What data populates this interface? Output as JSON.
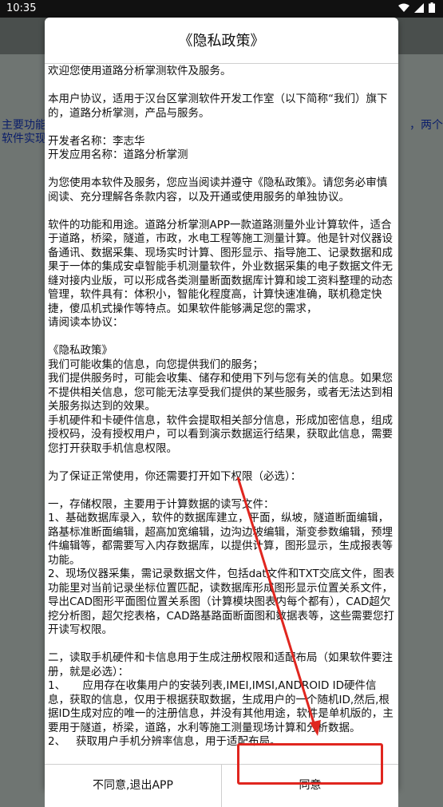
{
  "status_bar": {
    "time": "10:35"
  },
  "background": {
    "left_lines": [
      "主要功能",
      "软件实现"
    ],
    "right_lines": [
      "，两个"
    ]
  },
  "dialog": {
    "title": "《隐私政策》",
    "content": "欢迎您使用道路分析掌测软件及服务。\n\n本用户协议，适用于汉台区掌测软件开发工作室（以下简称“我们）旗下的，道路分析掌测，产品与服务。\n\n开发者名称：李志华\n开发应用名称：道路分析掌测\n\n为您使用本软件及服务，您应当阅读并遵守《隐私政策》。请您务必审慎阅读、充分理解各条款内容，以及开通或使用服务的单独协议。\n\n软件的功能和用途。道路分析掌测APP一款道路测量外业计算软件，适合于道路，桥梁，隧道，市政，水电工程等施工测量计算。他是针对仪器设备通讯、数据采集、现场实时计算、图形显示、指导施工、记录数据和成果于一体的集成安卓智能手机测量软件，外业数据采集的电子数据文件无缝对接内业版，可以形成各类测量断面数据库计算和竣工资料整理的动态管理，软件具有：体积小，智能化程度高，计算快速准确，联机稳定快捷，傻瓜机式操作等特点。如果软件能够满足您的需求，\n请阅读本协议：\n\n《隐私政策》\n我们可能收集的信息，向您提供我们的服务；\n我们提供服务时，可能会收集、储存和使用下列与您有关的信息。如果您不提供相关信息，您可能无法享受我们提供的某些服务，或者无法达到相关服务拟达到的效果。\n手机硬件和卡硬件信息，软件会提取相关部分信息，形成加密信息，组成授权码，没有授权用户，可以看到演示数据运行结果，获取此信息，需要您打开获取手机信息权限。\n\n为了保证正常使用，你还需要打开如下权限（必选）：\n\n一，存储权限，主要用于计算数据的读写文件：\n1、基础数据库录入，软件的数据库建立，平面，纵坡，隧道断面编辑，路基标准断面编辑，超高加宽编辑，边沟边坡编辑，渐变参数编辑，预埋件编辑等，都需要写入内存数据库，以提供计算，图形显示，生成报表等功能。\n2、现场仪器采集，需记录数据文件，包括dat文件和TXT交底文件，图表功能里对当前记录坐标位置匹配，读数据库形成图形显示位置关系文件，导出CAD图形平面图位置关系图（计算模块图表内每个都有），CAD超欠挖分析图，超欠挖表格，CAD路基路面断面图和数据表等，这些需要您打开读写权限。\n\n二，读取手机硬件和卡信息用于生成注册权限和适配布局（如果软件要注册，就是必选）：\n1、     应用存在收集用户的安装列表,IMEI,IMSI,ANDROID ID硬件信息，获取的信息，仅用于根据获取数据，生成用户的一个随机ID,然后,根据ID生成对应的唯一的注册信息，并没有其他用途，软件是单机版的，主要用于隧道，桥梁，道路，水利等施工测量现场计算和分析数据。\n2、   获取用户手机分辨率信息，用于适配布局。",
    "decline_label": "不同意,退出APP",
    "accept_label": "同意"
  },
  "colors": {
    "highlight": "#e0261f",
    "background_text": "#0b1e6a"
  }
}
